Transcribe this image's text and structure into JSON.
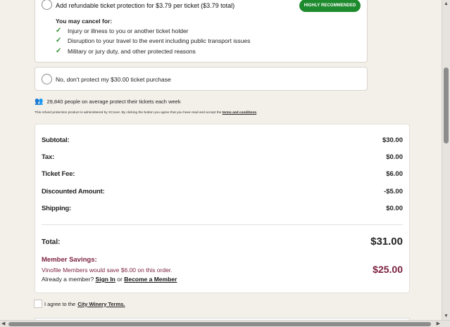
{
  "protection": {
    "option_yes": {
      "label": "Add refundable ticket protection for $3.79 per ticket ($3.79 total)",
      "badge": "HIGHLY RECOMMENDED",
      "cancel_heading": "You may cancel for:",
      "benefits": [
        "Injury or illness to you or another ticket holder",
        "Disruption to your travel to the event including public transport issues",
        "Military or jury duty, and other protected reasons"
      ]
    },
    "option_no": {
      "label": "No, don't protect my $30.00 ticket purchase"
    },
    "social_proof": "29,840 people on average protect their tickets each week",
    "disclaimer_text": "This refund protection product is administered by XCover. By clicking the button you agree that you have read and accept the",
    "disclaimer_link": "terms and conditions",
    "disclaimer_end": "."
  },
  "summary": {
    "rows": [
      {
        "label": "Subtotal:",
        "value": "$30.00"
      },
      {
        "label": "Tax:",
        "value": "$0.00"
      },
      {
        "label": "Ticket Fee:",
        "value": "$6.00"
      },
      {
        "label": "Discounted Amount:",
        "value": "-$5.00"
      },
      {
        "label": "Shipping:",
        "value": "$0.00"
      }
    ],
    "total_label": "Total:",
    "total_value": "$31.00",
    "member_savings_label": "Member Savings:",
    "member_savings_note": "Vinofile Members would save $6.00 on this order.",
    "member_savings_value": "$25.00",
    "already_member": "Already a member?",
    "sign_in": "Sign In",
    "or": "or",
    "become_member": "Become a Member"
  },
  "agree": {
    "text": "I agree to the",
    "link": "City Winery Terms."
  },
  "colors": {
    "badge_green": "#1e8a2e",
    "member_maroon": "#7a1f3f",
    "page_bg": "#f3efe9"
  }
}
